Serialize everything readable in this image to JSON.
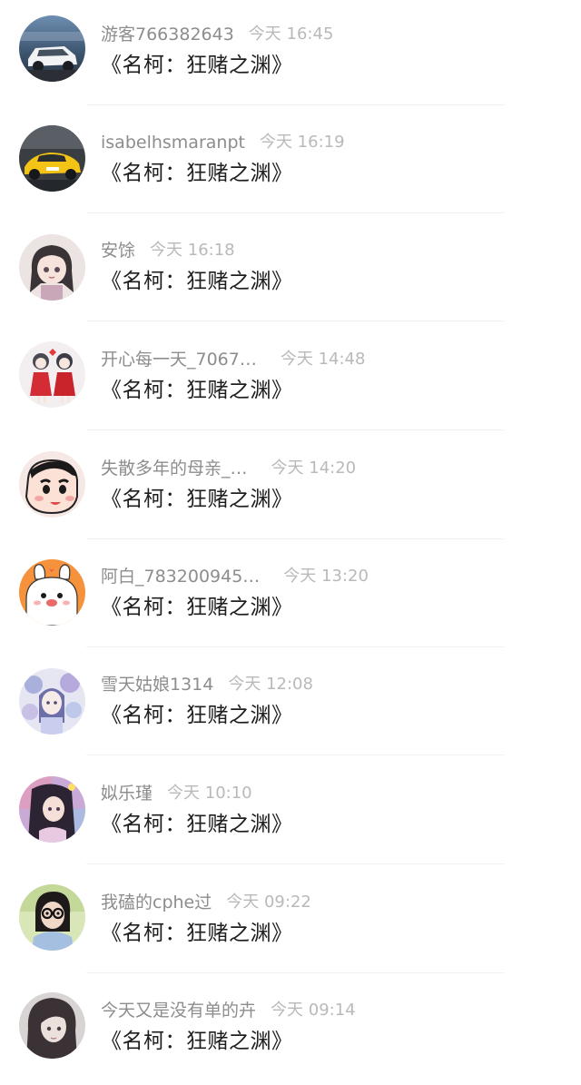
{
  "messages": [
    {
      "username": "游客766382643",
      "time": "今天 16:45",
      "title": "《名柯：狂赌之渊》",
      "avatar_icon": "car-white-suv-avatar"
    },
    {
      "username": "isabelhsmaranpt",
      "time": "今天 16:19",
      "title": "《名柯：狂赌之渊》",
      "avatar_icon": "car-yellow-sports-avatar"
    },
    {
      "username": "安馀",
      "time": "今天 16:18",
      "title": "《名柯：狂赌之渊》",
      "avatar_icon": "anime-girl-avatar"
    },
    {
      "username": "开心每一天_7067…",
      "time": "今天 14:48",
      "title": "《名柯：狂赌之渊》",
      "avatar_icon": "two-dolls-avatar"
    },
    {
      "username": "失散多年的母亲_…",
      "time": "今天 14:20",
      "title": "《名柯：狂赌之渊》",
      "avatar_icon": "crayon-shin-chan-avatar"
    },
    {
      "username": "阿白_783200945…",
      "time": "今天 13:20",
      "title": "《名柯：狂赌之渊》",
      "avatar_icon": "white-bunny-orange-avatar"
    },
    {
      "username": "雪天姑娘1314",
      "time": "今天 12:08",
      "title": "《名柯：狂赌之渊》",
      "avatar_icon": "blue-flower-girl-avatar"
    },
    {
      "username": "姒乐瑾",
      "time": "今天 10:10",
      "title": "《名柯：狂赌之渊》",
      "avatar_icon": "colorful-anime-avatar"
    },
    {
      "username": "我磕的cphe过",
      "time": "今天 09:22",
      "title": "《名柯：狂赌之渊》",
      "avatar_icon": "photo-girl-glasses-avatar"
    },
    {
      "username": "今天又是没有单的卉",
      "time": "今天 09:14",
      "title": "《名柯：狂赌之渊》",
      "avatar_icon": "dark-hair-anime-avatar"
    }
  ],
  "colors": {
    "username": "#8d8d8d",
    "time": "#b9b9b9",
    "title": "#1e1e1e",
    "divider": "#f1f1f1"
  }
}
